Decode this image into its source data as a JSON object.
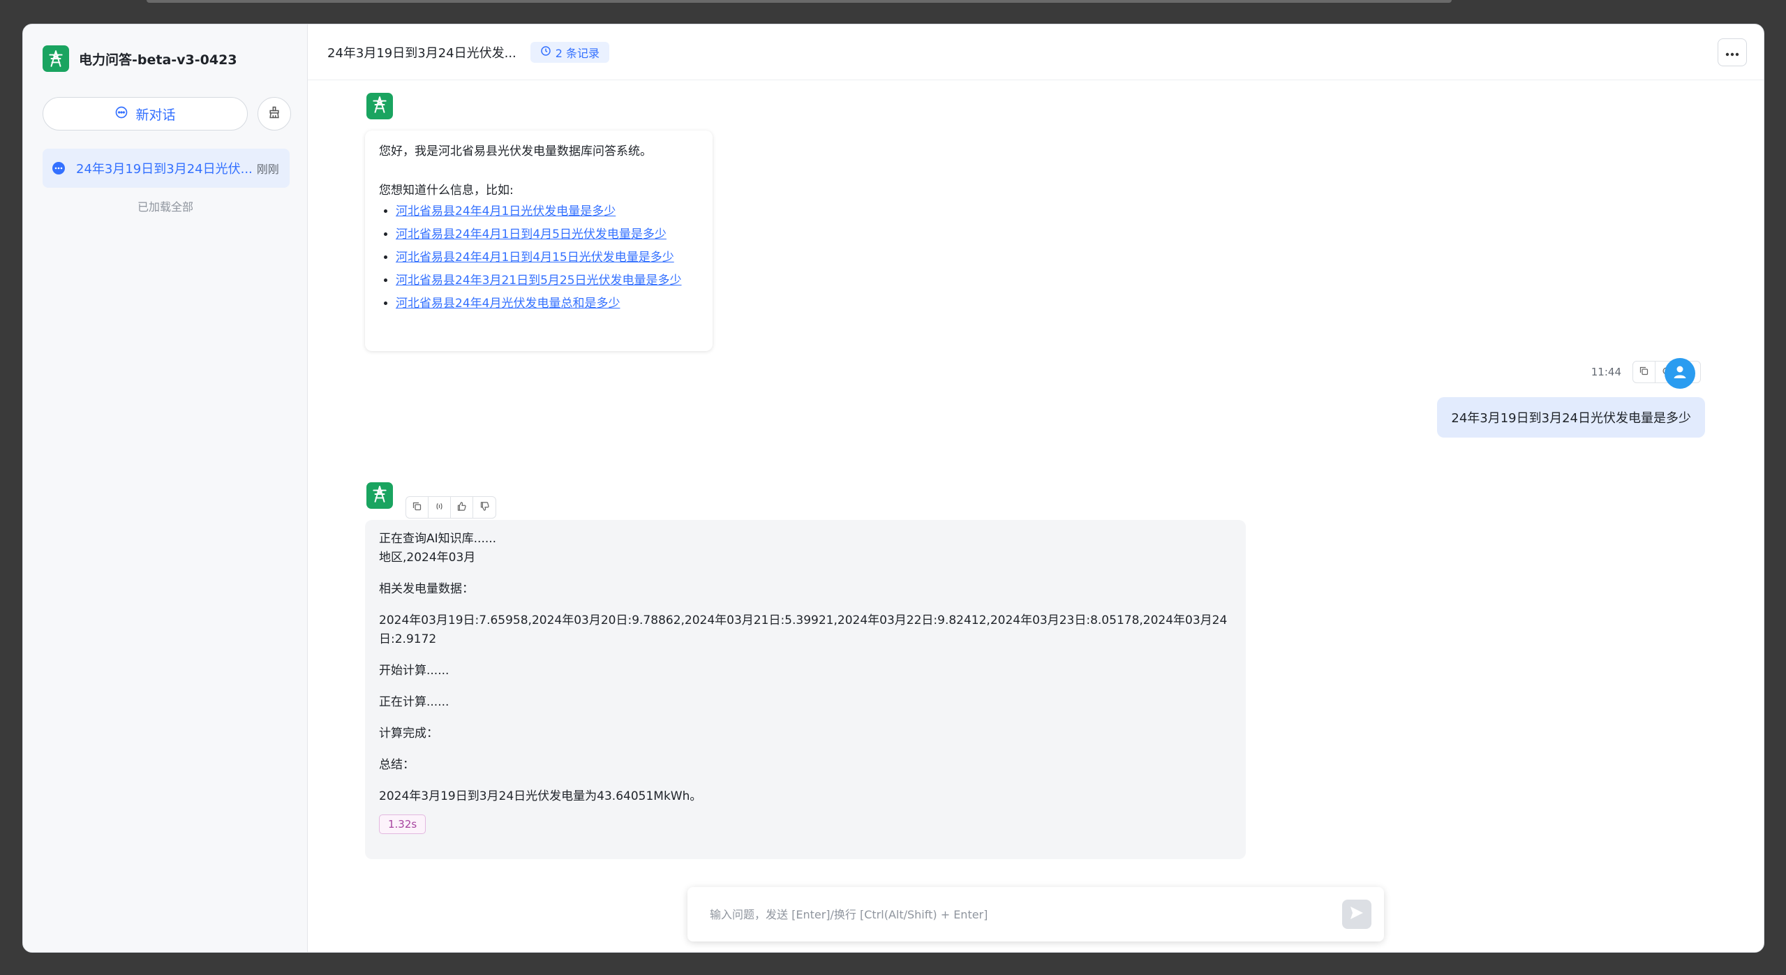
{
  "app": {
    "title": "电力问答-beta-v3-0423",
    "brand_color": "#1aa460",
    "accent_color": "#3370ff"
  },
  "sidebar": {
    "new_chat_label": "新对话",
    "clear_icon": "broom-icon",
    "history": [
      {
        "title": "24年3月19日到3月24日光伏...",
        "time": "刚刚"
      }
    ],
    "loaded_all": "已加载全部"
  },
  "header": {
    "chat_title": "24年3月19日到3月24日光伏发...",
    "record_badge": "2 条记录",
    "more_icon": "ellipsis-icon"
  },
  "welcome": {
    "greeting": "您好，我是河北省易县光伏发电量数据库问答系统。",
    "prompt": "您想知道什么信息，比如:",
    "suggestions": [
      "河北省易县24年4月1日光伏发电量是多少",
      "河北省易县24年4月1日到4月5日光伏发电量是多少",
      "河北省易县24年4月1日到4月15日光伏发电量是多少",
      "河北省易县24年3月21日到5月25日光伏发电量是多少",
      "河北省易县24年4月光伏发电量总和是多少"
    ]
  },
  "user_message": {
    "time": "11:44",
    "text": "24年3月19日到3月24日光伏发电量是多少"
  },
  "answer": {
    "line1": "正在查询AI知识库......",
    "line2": "地区,2024年03月",
    "line3": "相关发电量数据：",
    "line4": "2024年03月19日:7.65958,2024年03月20日:9.78862,2024年03月21日:5.39921,2024年03月22日:9.82412,2024年03月23日:8.05178,2024年03月24日:2.9172",
    "line5": "开始计算......",
    "line6": "正在计算......",
    "line7": "计算完成：",
    "line8": "总结：",
    "line9": "2024年3月19日到3月24日光伏发电量为43.64051MkWh。",
    "duration": "1.32s"
  },
  "input": {
    "placeholder": "输入问题，发送 [Enter]/换行 [Ctrl(Alt/Shift) + Enter]",
    "value": ""
  }
}
